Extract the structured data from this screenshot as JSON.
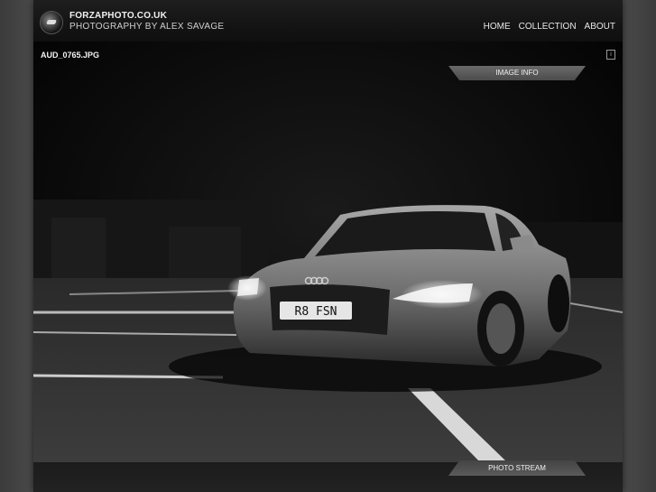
{
  "header": {
    "site_title": "FORZAPHOTO.CO.UK",
    "subtitle": "PHOTOGRAPHY BY ALEX SAVAGE",
    "nav": [
      "HOME",
      "COLLECTION",
      "ABOUT"
    ]
  },
  "image": {
    "filename": "AUD_0765.JPG",
    "plate": "R8 FSN"
  },
  "tabs": {
    "image_info": "IMAGE INFO",
    "photo_stream": "PHOTO STREAM"
  },
  "icons": {
    "logo": "camera-logo-icon",
    "info": "info-icon"
  }
}
